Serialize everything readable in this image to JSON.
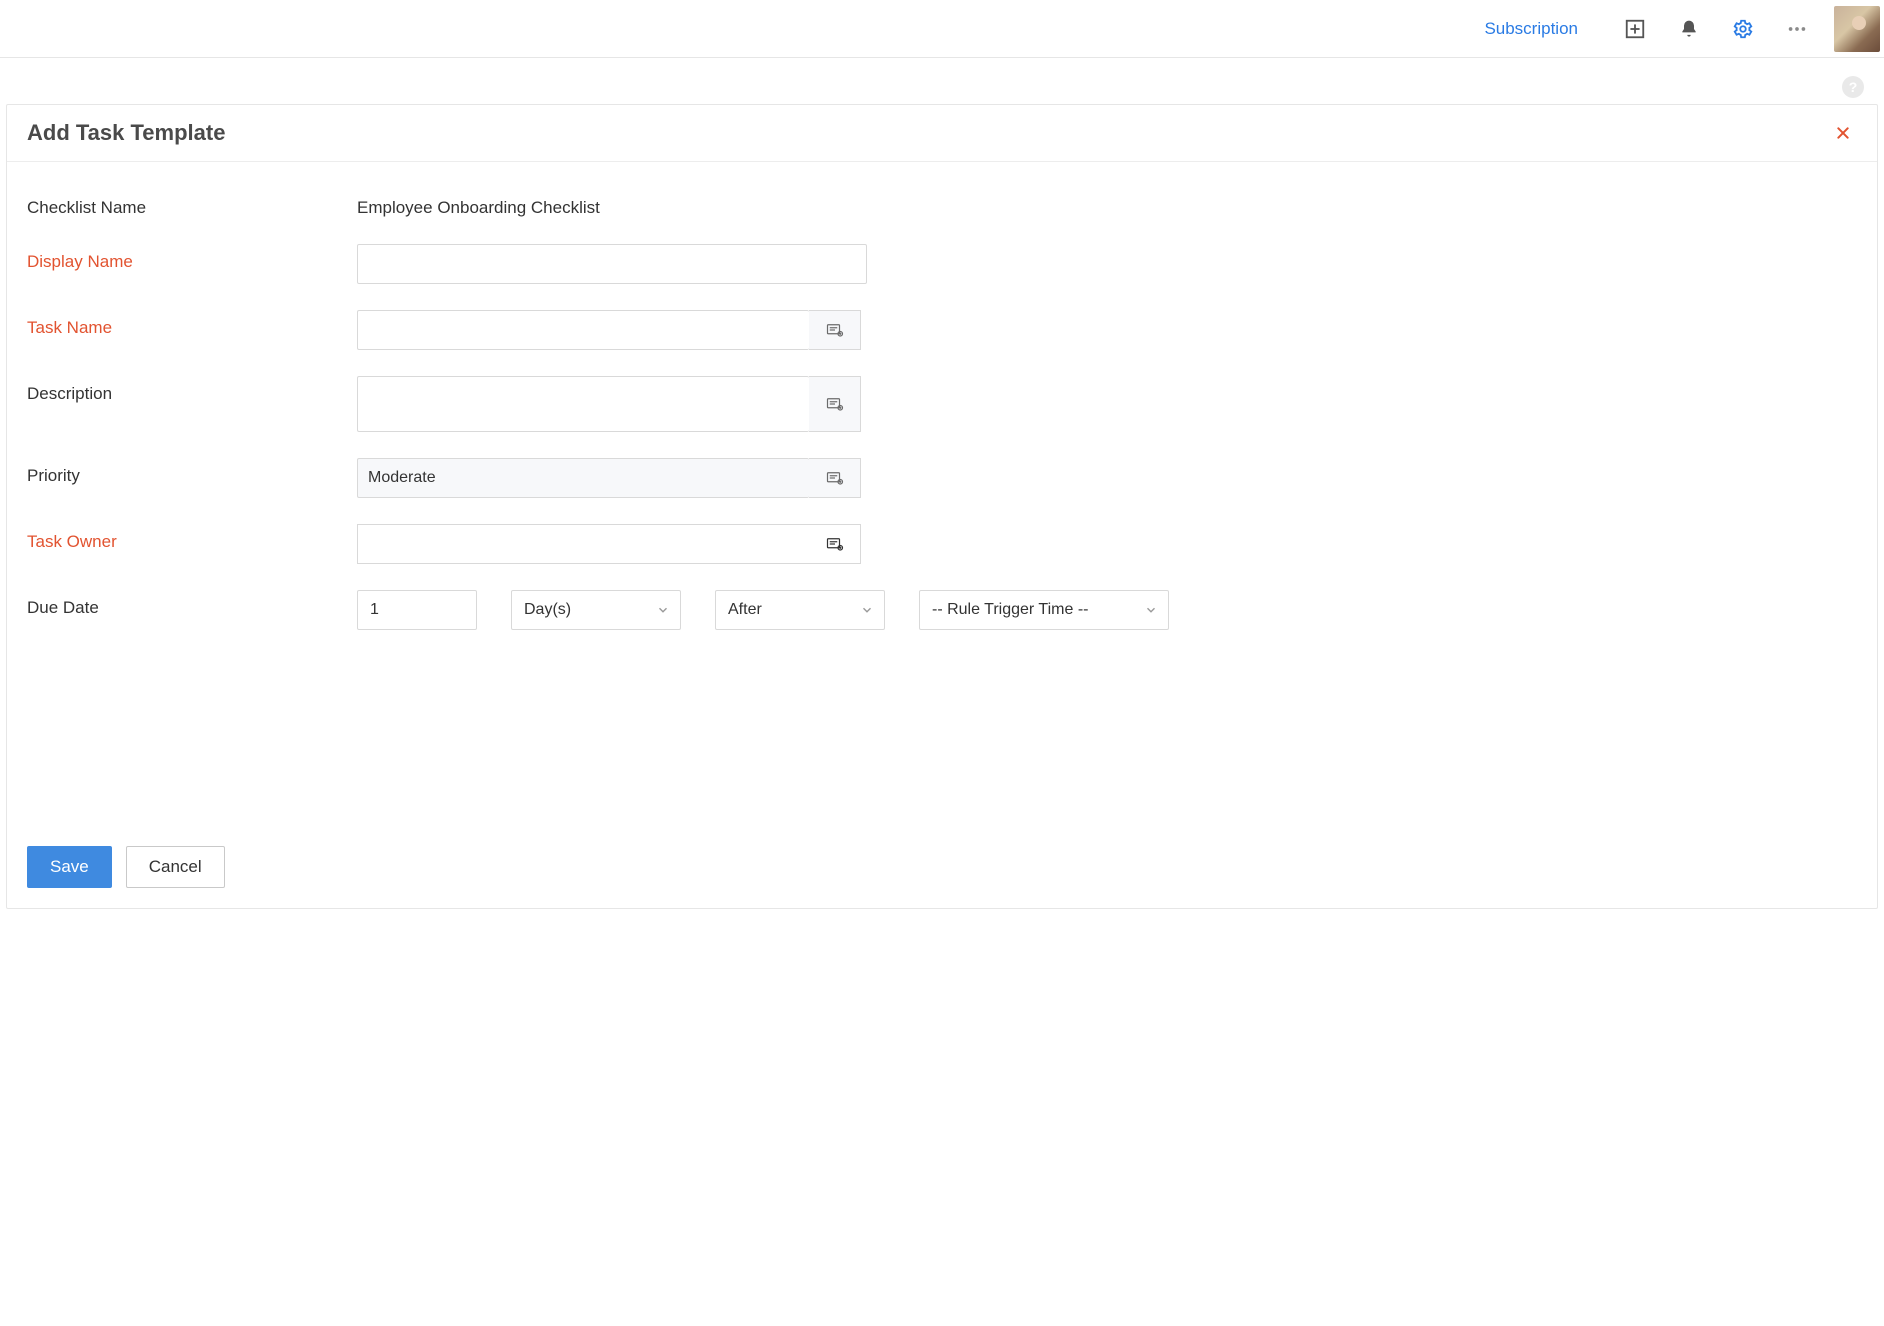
{
  "topbar": {
    "subscription_label": "Subscription"
  },
  "panel": {
    "title": "Add Task Template"
  },
  "form": {
    "checklist_name_label": "Checklist Name",
    "checklist_name_value": "Employee Onboarding Checklist",
    "display_name_label": "Display Name",
    "display_name_value": "",
    "task_name_label": "Task Name",
    "task_name_value": "",
    "description_label": "Description",
    "description_value": "",
    "priority_label": "Priority",
    "priority_value": "Moderate",
    "task_owner_label": "Task Owner",
    "task_owner_value": "",
    "due_date_label": "Due Date",
    "due_date_number": "1",
    "due_date_unit": "Day(s)",
    "due_date_relation": "After",
    "due_date_reference": "-- Rule Trigger Time --"
  },
  "footer": {
    "save_label": "Save",
    "cancel_label": "Cancel"
  },
  "help": {
    "glyph": "?"
  }
}
